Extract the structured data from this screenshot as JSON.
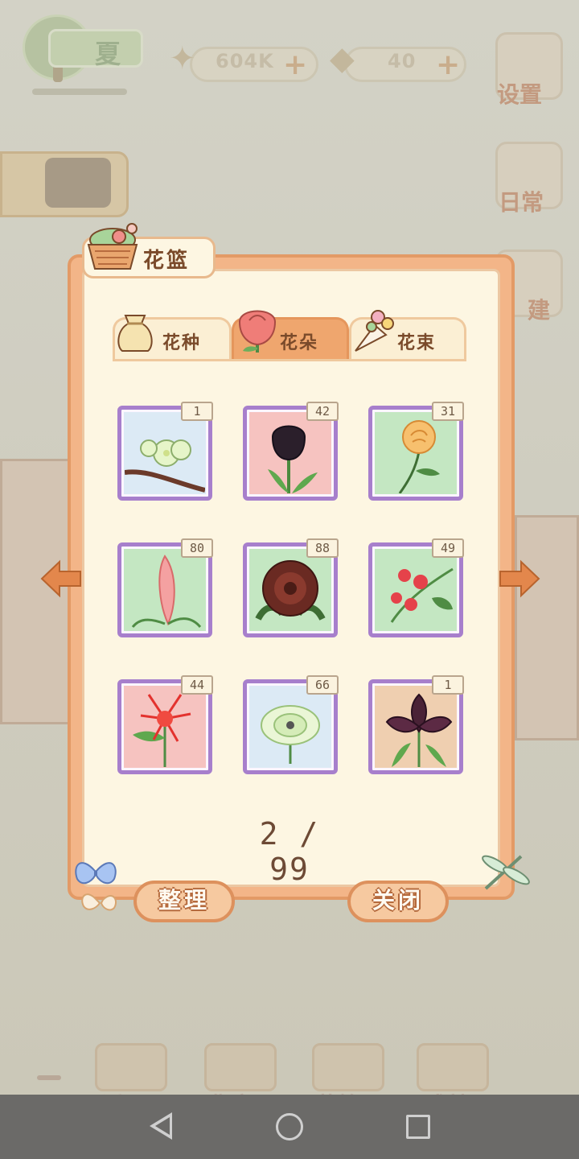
{
  "hud": {
    "season_label": "夏",
    "fish_value": "604K",
    "cheese_value": "40",
    "plus_symbol": "+"
  },
  "side_menu": {
    "settings_label": "设置",
    "daily_label": "日常",
    "build_label": "建"
  },
  "bottom_nav": {
    "back_label": "返回",
    "market_label": "集市",
    "basket_label": "花篮",
    "achievement_label": "成就"
  },
  "modal": {
    "title": "花篮",
    "tabs": [
      {
        "label": "花种",
        "icon": "seed-bag-icon",
        "active": false
      },
      {
        "label": "花朵",
        "icon": "rose-icon",
        "active": true
      },
      {
        "label": "花束",
        "icon": "bouquet-icon",
        "active": false
      }
    ],
    "items": [
      {
        "name": "white-blossom-branch",
        "count": "1",
        "bg": "#dceaf5"
      },
      {
        "name": "black-tulip",
        "count": "42",
        "bg": "#f6c3c0"
      },
      {
        "name": "orange-rose",
        "count": "31",
        "bg": "#c4e7c2"
      },
      {
        "name": "pink-celosia",
        "count": "80",
        "bg": "#c4e7c2"
      },
      {
        "name": "dark-peony",
        "count": "88",
        "bg": "#c4e7c2"
      },
      {
        "name": "red-flower-cluster",
        "count": "49",
        "bg": "#c4e7c2"
      },
      {
        "name": "red-spider-lily",
        "count": "44",
        "bg": "#f6c3c0"
      },
      {
        "name": "white-green-flower",
        "count": "66",
        "bg": "#dceaf5"
      },
      {
        "name": "dark-iris",
        "count": "1",
        "bg": "#efcfb0"
      }
    ],
    "page_indicator": "2 / 99",
    "sort_button": "整理",
    "close_button": "关闭"
  },
  "colors": {
    "panel_border": "#e39a66",
    "panel_fill": "#fdf6e2",
    "slot_border": "#a77fcc",
    "arrow": "#e3874c"
  }
}
